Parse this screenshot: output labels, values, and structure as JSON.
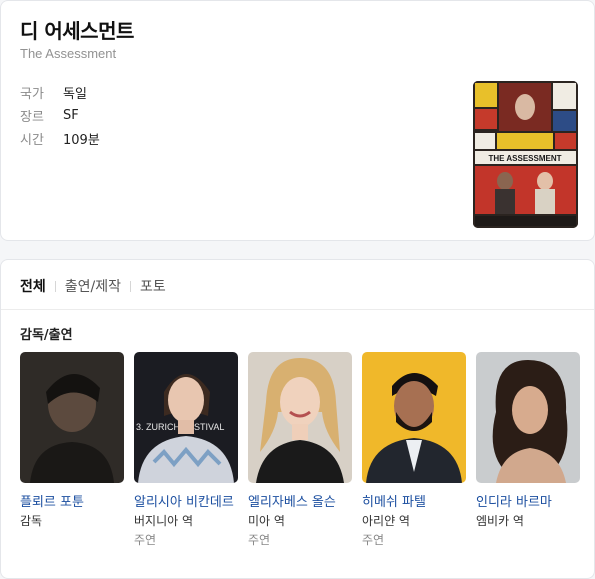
{
  "movie": {
    "title": "디 어세스먼트",
    "original_title": "The Assessment",
    "info": [
      {
        "label": "국가",
        "value": "독일"
      },
      {
        "label": "장르",
        "value": "SF"
      },
      {
        "label": "시간",
        "value": "109분"
      }
    ],
    "poster": {
      "title_text": "THE  ASSESSMENT"
    }
  },
  "tabs": [
    {
      "label": "전체",
      "active": true
    },
    {
      "label": "출연/제작",
      "active": false
    },
    {
      "label": "포토",
      "active": false
    }
  ],
  "section_title": "감독/출연",
  "people": [
    {
      "name": "플뢰르 포툰",
      "role": "감독",
      "type": ""
    },
    {
      "name": "알리시아 비칸데르",
      "role": "버지니아 역",
      "type": "주연",
      "photo_text": "3. ZURICH    FESTIVAL"
    },
    {
      "name": "엘리자베스 올슨",
      "role": "미아 역",
      "type": "주연"
    },
    {
      "name": "히메쉬 파텔",
      "role": "아리얀 역",
      "type": "주연"
    },
    {
      "name": "인디라 바르마",
      "role": "엠비카 역",
      "type": ""
    }
  ],
  "colors": {
    "link": "#1c4fa0",
    "label": "#8b8b8b",
    "poster_accent": "#e8c02a"
  }
}
